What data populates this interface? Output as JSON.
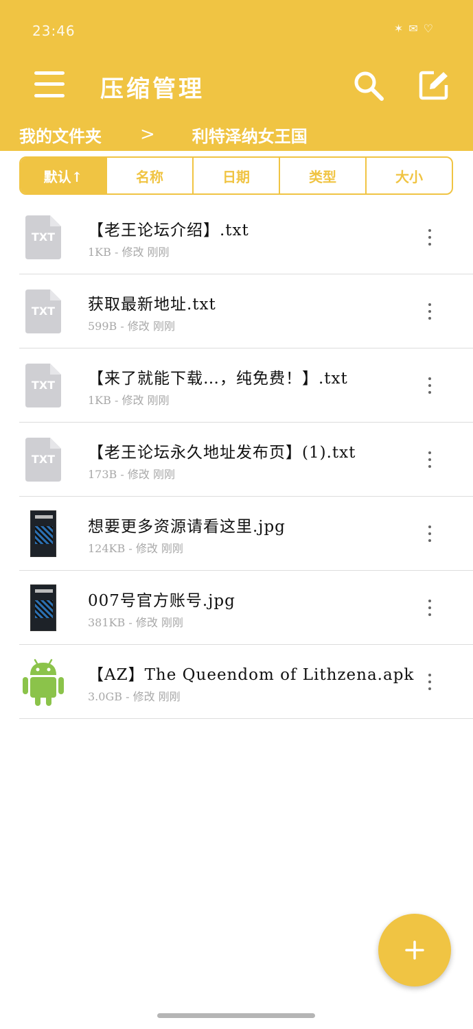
{
  "colors": {
    "accent": "#F0C443",
    "file_icon_gray": "#cfcfd3",
    "android_green": "#8BC34A"
  },
  "status_bar": {
    "time": "23:46"
  },
  "header": {
    "title": "压缩管理"
  },
  "breadcrumb": {
    "root": "我的文件夹",
    "separator": ">",
    "current": "利特泽纳女王国"
  },
  "sort_tabs": [
    "默认↑",
    "名称",
    "日期",
    "类型",
    "大小"
  ],
  "files": [
    {
      "name": "【老王论坛介绍】.txt",
      "meta": "1KB - 修改 刚刚",
      "type": "txt",
      "icon_label": "TXT"
    },
    {
      "name": "获取最新地址.txt",
      "meta": "599B - 修改 刚刚",
      "type": "txt",
      "icon_label": "TXT"
    },
    {
      "name": "【来了就能下载…，纯免费！】.txt",
      "meta": "1KB - 修改 刚刚",
      "type": "txt",
      "icon_label": "TXT"
    },
    {
      "name": "【老王论坛永久地址发布页】(1).txt",
      "meta": "173B - 修改 刚刚",
      "type": "txt",
      "icon_label": "TXT"
    },
    {
      "name": "想要更多资源请看这里.jpg",
      "meta": "124KB - 修改 刚刚",
      "type": "jpg"
    },
    {
      "name": "007号官方账号.jpg",
      "meta": "381KB - 修改 刚刚",
      "type": "jpg"
    },
    {
      "name": "【AZ】The Queendom of Lithzena.apk",
      "meta": "3.0GB - 修改 刚刚",
      "type": "apk"
    }
  ]
}
